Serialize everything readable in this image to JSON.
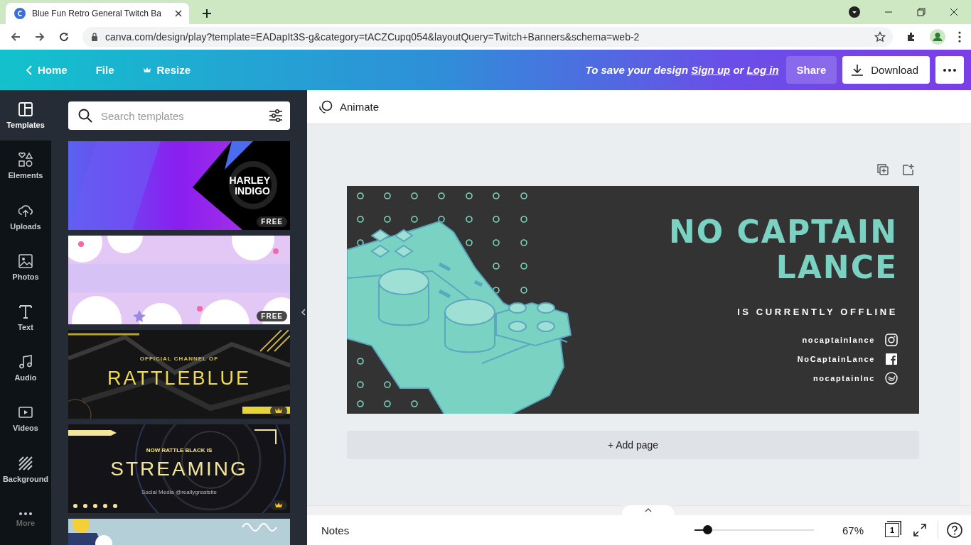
{
  "browser": {
    "tab_title": "Blue Fun Retro General Twitch Ba",
    "url": "canva.com/design/play?template=EADapIt3S-g&category=tACZCupq054&layoutQuery=Twitch+Banners&schema=web-2"
  },
  "header": {
    "nav": [
      {
        "label": "Home",
        "kind": "back"
      },
      {
        "label": "File",
        "kind": "plain"
      },
      {
        "label": "Resize",
        "kind": "crown"
      }
    ],
    "save_prompt": {
      "before": "To save your design",
      "signup": "Sign up",
      "middle": "or",
      "login": "Log in"
    },
    "share": "Share",
    "download": "Download"
  },
  "sidebar": {
    "items": [
      {
        "label": "Templates",
        "kind": "templates",
        "selected": true
      },
      {
        "label": "Elements",
        "kind": "elements",
        "selected": false
      },
      {
        "label": "Uploads",
        "kind": "uploads",
        "selected": false
      },
      {
        "label": "Photos",
        "kind": "photos",
        "selected": false
      },
      {
        "label": "Text",
        "kind": "text",
        "selected": false
      },
      {
        "label": "Audio",
        "kind": "audio",
        "selected": false
      },
      {
        "label": "Videos",
        "kind": "videos",
        "selected": false
      },
      {
        "label": "Background",
        "kind": "background",
        "selected": false
      },
      {
        "label": "More",
        "kind": "more",
        "selected": false
      }
    ]
  },
  "panel": {
    "search": {
      "placeholder": "Search templates"
    },
    "templates": [
      {
        "kind": "harley",
        "badge": "FREE",
        "texts": [
          "HARLEY",
          "INDIGO"
        ]
      },
      {
        "kind": "clouds",
        "badge": "FREE"
      },
      {
        "kind": "rattle",
        "premium": true,
        "texts": [
          "OFFICIAL CHANNEL OF",
          "RATTLEBLUE"
        ]
      },
      {
        "kind": "streaming",
        "premium": true,
        "texts": [
          "NOW RATTLE BLACK IS",
          "STREAMING",
          "Social Media @reallygreatsite"
        ]
      },
      {
        "kind": "sky"
      }
    ]
  },
  "toolbar": {
    "animate": "Animate"
  },
  "design": {
    "title_lines": [
      "NO CAPTAIN",
      "LANCE"
    ],
    "subtitle": "IS CURRENTLY OFFLINE",
    "socials": [
      {
        "handle": "nocaptainlance",
        "kind": "instagram"
      },
      {
        "handle": "NoCaptainLance",
        "kind": "facebook"
      },
      {
        "handle": "nocaptainlnc",
        "kind": "twitter"
      }
    ]
  },
  "add_page": "+ Add page",
  "footer": {
    "notes": "Notes",
    "zoom": {
      "level": 0.11
    },
    "zoom_reading": "67%",
    "page_count": "1"
  }
}
